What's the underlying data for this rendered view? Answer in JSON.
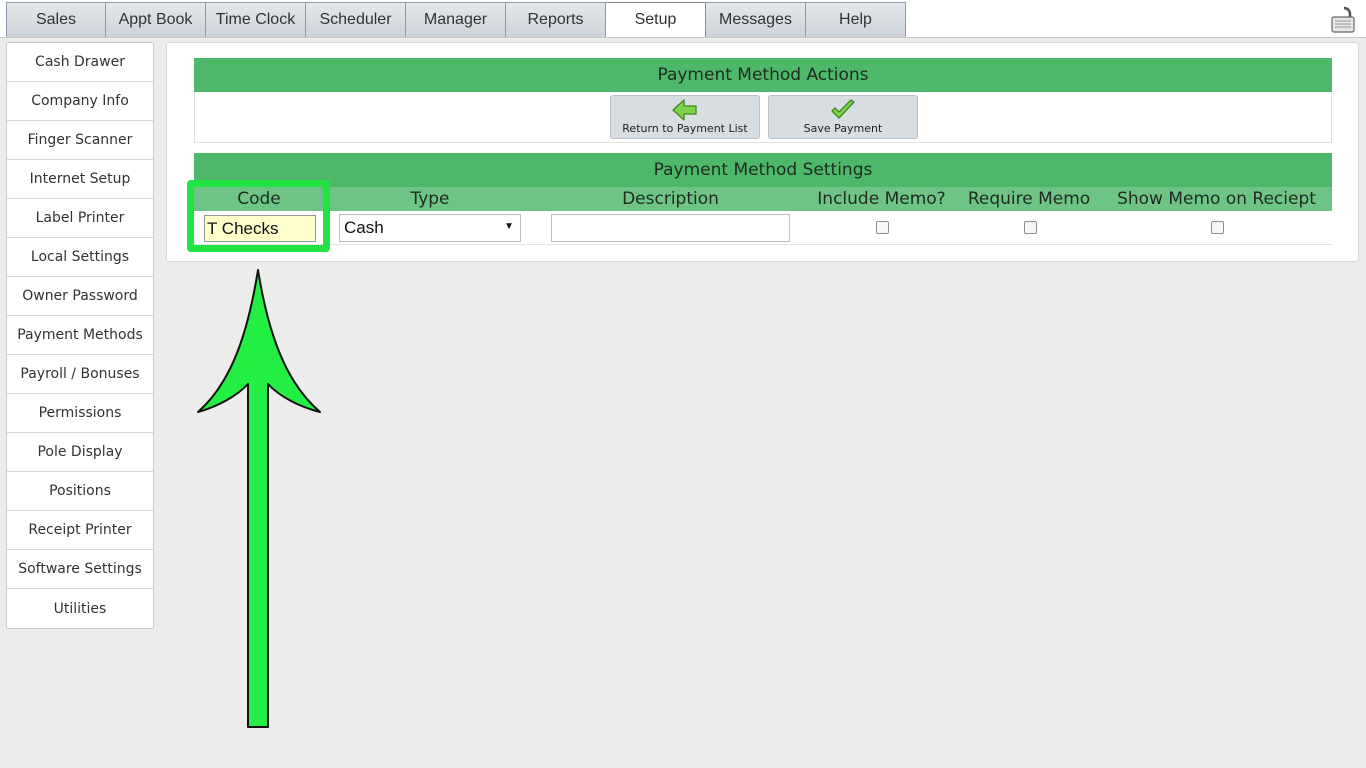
{
  "tabs": [
    {
      "label": "Sales"
    },
    {
      "label": "Appt Book"
    },
    {
      "label": "Time Clock"
    },
    {
      "label": "Scheduler"
    },
    {
      "label": "Manager"
    },
    {
      "label": "Reports"
    },
    {
      "label": "Setup",
      "active": true
    },
    {
      "label": "Messages"
    },
    {
      "label": "Help"
    }
  ],
  "header_icon": "lock-icon",
  "sidebar": {
    "items": [
      {
        "label": "Cash Drawer"
      },
      {
        "label": "Company Info"
      },
      {
        "label": "Finger Scanner"
      },
      {
        "label": "Internet Setup"
      },
      {
        "label": "Label Printer"
      },
      {
        "label": "Local Settings"
      },
      {
        "label": "Owner Password"
      },
      {
        "label": "Payment Methods"
      },
      {
        "label": "Payroll / Bonuses"
      },
      {
        "label": "Permissions"
      },
      {
        "label": "Pole Display"
      },
      {
        "label": "Positions"
      },
      {
        "label": "Receipt Printer"
      },
      {
        "label": "Software Settings"
      },
      {
        "label": "Utilities"
      }
    ]
  },
  "actions": {
    "title": "Payment Method Actions",
    "return_label": "Return to Payment List",
    "return_icon": "back-arrow-icon",
    "save_label": "Save Payment",
    "save_icon": "checkmark-icon"
  },
  "settings": {
    "title": "Payment Method Settings",
    "columns": {
      "code": "Code",
      "type": "Type",
      "description": "Description",
      "include_memo": "Include Memo?",
      "require_memo": "Require Memo",
      "show_memo": "Show Memo on Reciept"
    },
    "row": {
      "code": "T Checks",
      "type": "Cash",
      "description": "",
      "include_memo": false,
      "require_memo": false,
      "show_memo": false
    }
  },
  "colors": {
    "header_green": "#4db86a",
    "column_green": "#6ec486",
    "highlight_green": "#22e244",
    "code_field_bg": "#ffffcc"
  }
}
